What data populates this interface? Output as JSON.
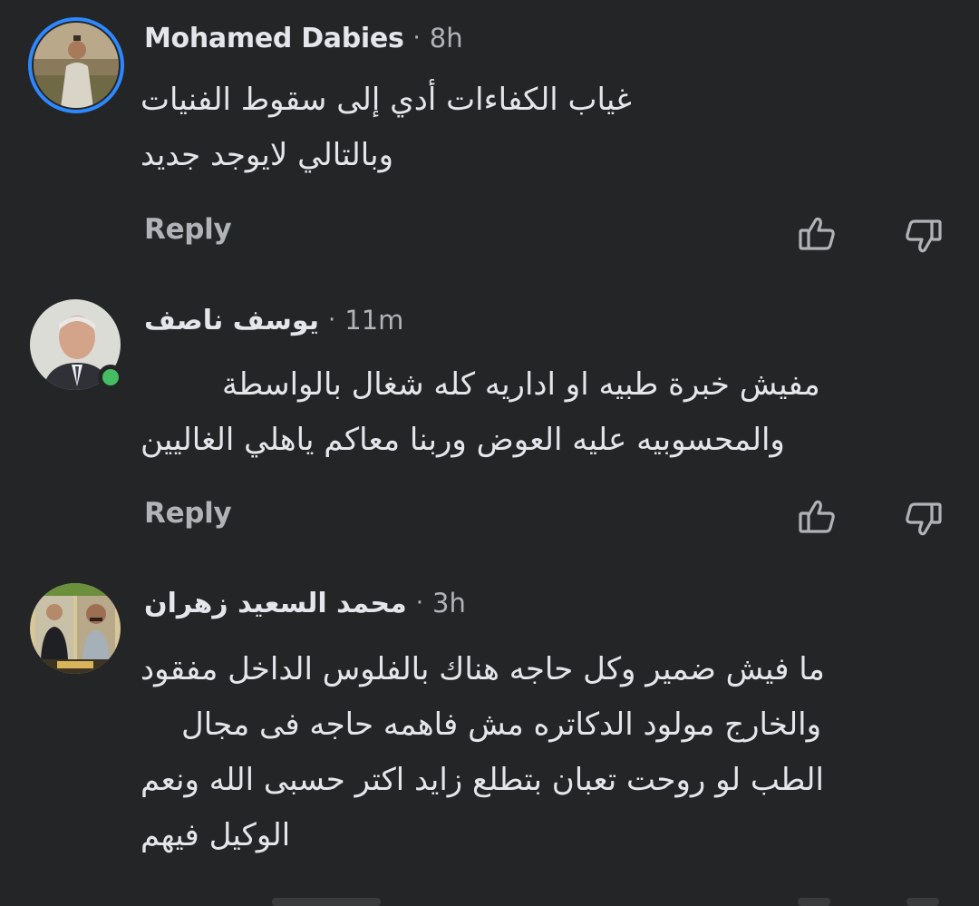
{
  "colors": {
    "background": "#242526",
    "primary_text": "#e4e6eb",
    "secondary_text": "#b0b3b8",
    "story_ring": "#2d88ff",
    "online": "#45bd62"
  },
  "comments": [
    {
      "author": "Mohamed Dabies",
      "separator": "·",
      "time": "8h",
      "lines": [
        "غياب الكفاءات أدي إلى سقوط الفنيات",
        "وبالتالي لايوجد جديد"
      ],
      "reply_label": "Reply",
      "like_icon": "thumbs-up-icon",
      "dislike_icon": "thumbs-down-icon"
    },
    {
      "author": "يوسف ناصف",
      "separator": "·",
      "time": "11m",
      "lines": [
        "مفيش خبرة طبيه او اداريه كله شغال بالواسطة",
        "والمحسوبيه عليه العوض وربنا معاكم ياهلي الغاليين"
      ],
      "reply_label": "Reply",
      "like_icon": "thumbs-up-icon",
      "dislike_icon": "thumbs-down-icon"
    },
    {
      "author": "محمد السعيد زهران",
      "separator": "·",
      "time": "3h",
      "lines": [
        "ما فيش ضمير وكل حاجه هناك بالفلوس الداخل مفقود",
        "والخارج مولود الدكاتره مش فاهمه حاجه فى مجال",
        "الطب لو روحت تعبان بتطلع زايد اكتر حسبى الله ونعم",
        "الوكيل فيهم"
      ]
    }
  ]
}
